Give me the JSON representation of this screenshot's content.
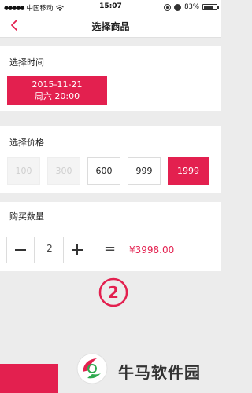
{
  "status_bar": {
    "carrier": "中国移动",
    "time": "15:07",
    "battery_percent": "83%",
    "battery_level": 0.83
  },
  "nav": {
    "title": "选择商品",
    "back_icon": "chevron-left-icon"
  },
  "time_section": {
    "title": "选择时间",
    "selected_date": "2015-11-21",
    "selected_time": "周六 20:00"
  },
  "price_section": {
    "title": "选择价格",
    "options": [
      {
        "label": "100",
        "state": "disabled"
      },
      {
        "label": "300",
        "state": "disabled"
      },
      {
        "label": "600",
        "state": "normal"
      },
      {
        "label": "999",
        "state": "normal"
      },
      {
        "label": "1999",
        "state": "selected"
      }
    ]
  },
  "quantity_section": {
    "title": "购买数量",
    "quantity": "2",
    "equals": "=",
    "total": "¥3998.00"
  },
  "step_marker": "2",
  "watermark": {
    "text": "牛马软件园"
  },
  "colors": {
    "accent": "#e3204f",
    "background": "#ececec"
  }
}
